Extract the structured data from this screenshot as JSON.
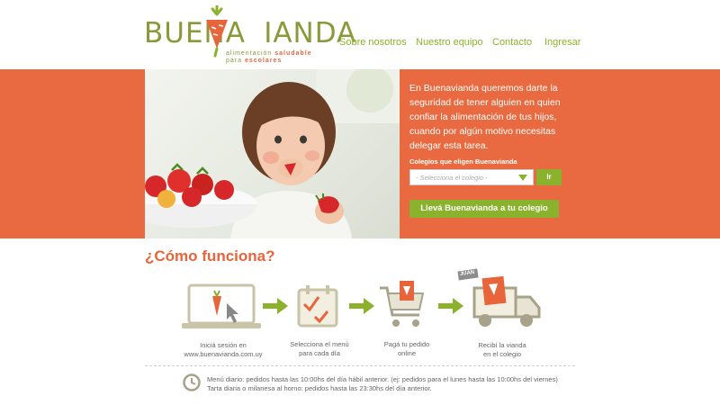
{
  "brand": {
    "name_part1": "BUENA",
    "name_v": "V",
    "name_part2": "IANDA",
    "tagline_line1_plain": "alimentación ",
    "tagline_line1_bold": "saludable",
    "tagline_line2_plain": "para ",
    "tagline_line2_bold": "escolares",
    "colors": {
      "orange": "#e8643a",
      "green": "#8ab22c",
      "olive": "#8a9a3a"
    }
  },
  "nav": {
    "items": [
      "Sobre nosotros",
      "Nuestro equipo",
      "Contacto",
      "Ingresar"
    ]
  },
  "hero": {
    "copy": "En Buenavianda queremos darte la seguridad de tener alguien en quien confiar la alimentación de tus hijos, cuando por algún motivo necesitas delegar esta tarea.",
    "select_label": "Colegios que eligen Buenavianda",
    "select_placeholder": "- Selecciona el colegio -",
    "go_button": "Ir",
    "cta_button": "Llevá Buenavianda a tu colegio"
  },
  "how": {
    "title": "¿Cómo funciona?",
    "steps": [
      {
        "icon": "laptop-login-icon",
        "line1": "Iniciá sesión en",
        "line2": "www.buenavianda.com.uy"
      },
      {
        "icon": "calendar-check-icon",
        "line1": "Selecciona el menú",
        "line2": "para cada día"
      },
      {
        "icon": "shopping-cart-icon",
        "line1": "Pagá tu pedido",
        "line2": "online"
      },
      {
        "icon": "delivery-truck-icon",
        "line1": "Recibí la vianda",
        "line2": "en el colegio"
      }
    ],
    "truck_tag": "JUAN"
  },
  "schedule": {
    "line1": "Menú diario: pedidos hasta las 10:00hs del día hábil anterior. (ej: pedidos para el lunes hasta las 10:00hs del viernes)",
    "line2": "Tarta diaria o milanesa al horno: pedidos hasta las 23:30hs del día anterior."
  }
}
